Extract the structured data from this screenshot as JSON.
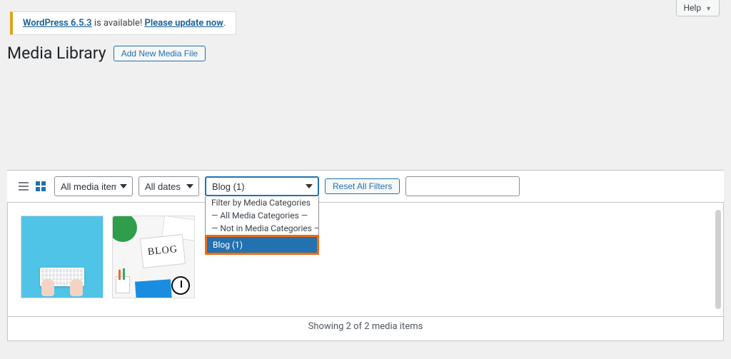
{
  "help": {
    "label": "Help"
  },
  "update_nag": {
    "prefix_link": "WordPress 6.5.3",
    "middle": " is available! ",
    "action_link": "Please update now",
    "period": "."
  },
  "page_title": "Media Library",
  "add_button": "Add New Media File",
  "filters": {
    "media_type": "All media items",
    "dates": "All dates",
    "category": "Blog  (1)",
    "reset": "Reset All Filters"
  },
  "dropdown": {
    "header": "Filter by Media Categories",
    "all": "— All Media Categories —",
    "not_in": "— Not in Media Categories —",
    "blog": "Blog  (1)"
  },
  "thumb2_text": "BLOG",
  "status_text": "Showing 2 of 2 media items"
}
